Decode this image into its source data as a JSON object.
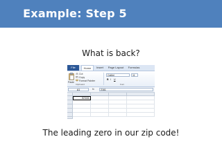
{
  "slide": {
    "title": "Example: Step 5",
    "question": "What is back?",
    "answer": "The leading zero in our zip code!",
    "banner_color": "#4f81bd"
  },
  "screenshot": {
    "ribbon_tabs": [
      {
        "label": "File",
        "active": false
      },
      {
        "label": "Home",
        "active": true
      },
      {
        "label": "Insert",
        "active": false
      },
      {
        "label": "Page Layout",
        "active": false
      },
      {
        "label": "Formulas",
        "active": false
      }
    ],
    "clipboard": {
      "paste_label": "Paste",
      "cut_label": "Cut",
      "copy_label": "Copy",
      "format_painter_label": "Format Painter",
      "group_label": "Clipboard"
    },
    "font": {
      "font_name": "Calibri",
      "font_size": "11",
      "group_label": "Font"
    },
    "formula_bar": {
      "name_box": "A1",
      "fx_label": "fx",
      "value": "2161"
    },
    "active_cell_value": "02161",
    "highlight_color": "#e00000"
  }
}
